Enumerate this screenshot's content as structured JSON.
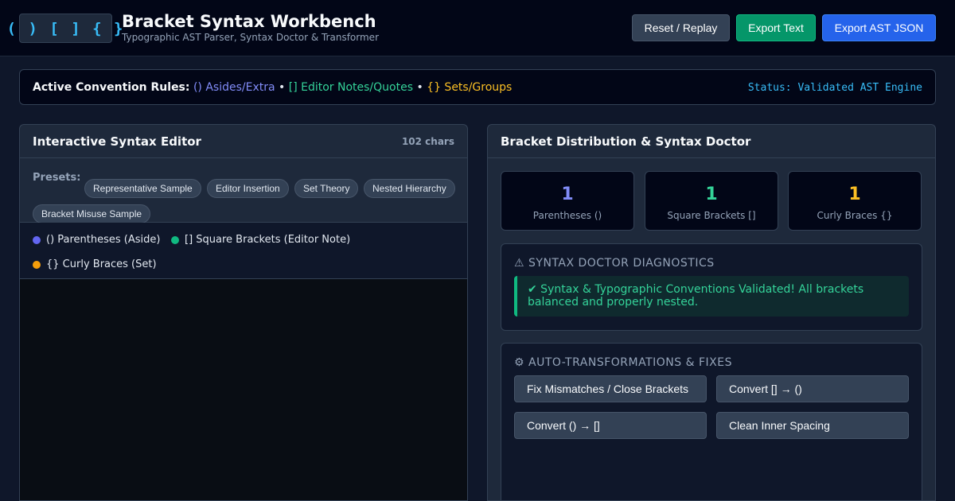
{
  "header": {
    "logo": "( ) [ ] { }",
    "title": "Bracket Syntax Workbench",
    "subtitle": "Typographic AST Parser, Syntax Doctor & Transformer",
    "buttons": {
      "reset": "Reset / Replay",
      "export_text": "Export Text",
      "export_json": "Export AST JSON"
    }
  },
  "rules": {
    "label": "Active Convention Rules:",
    "paren": "() Asides/Extra",
    "square": "[] Editor Notes/Quotes",
    "curly": "{} Sets/Groups",
    "separator": "•",
    "status": "Status: Validated AST Engine"
  },
  "editor": {
    "title": "Interactive Syntax Editor",
    "char_count": "102 chars",
    "presets_label": "Presets:",
    "presets": [
      "Representative Sample",
      "Editor Insertion",
      "Set Theory",
      "Nested Hierarchy",
      "Bracket Misuse Sample"
    ],
    "legend": [
      {
        "label": "() Parentheses (Aside)",
        "color": "#6366f1"
      },
      {
        "label": "[] Square Brackets (Editor Note)",
        "color": "#10b981"
      },
      {
        "label": "{} Curly Braces (Set)",
        "color": "#f59e0b"
      }
    ]
  },
  "doctor": {
    "title": "Bracket Distribution & Syntax Doctor",
    "counters": [
      {
        "value": "1",
        "label": "Parentheses ()",
        "color": "#818cf8"
      },
      {
        "value": "1",
        "label": "Square Brackets []",
        "color": "#34d399"
      },
      {
        "value": "1",
        "label": "Curly Braces {}",
        "color": "#fbbf24"
      }
    ],
    "diagnostics_heading": "⚠ SYNTAX DOCTOR DIAGNOSTICS",
    "diagnostics_message": "✔ Syntax & Typographic Conventions Validated! All brackets balanced and properly nested.",
    "fixes_heading": "⚙ AUTO-TRANSFORMATIONS & FIXES",
    "fixes": [
      "Fix Mismatches / Close Brackets",
      "Convert [] → ()",
      "Convert () → []",
      "Clean Inner Spacing"
    ]
  }
}
